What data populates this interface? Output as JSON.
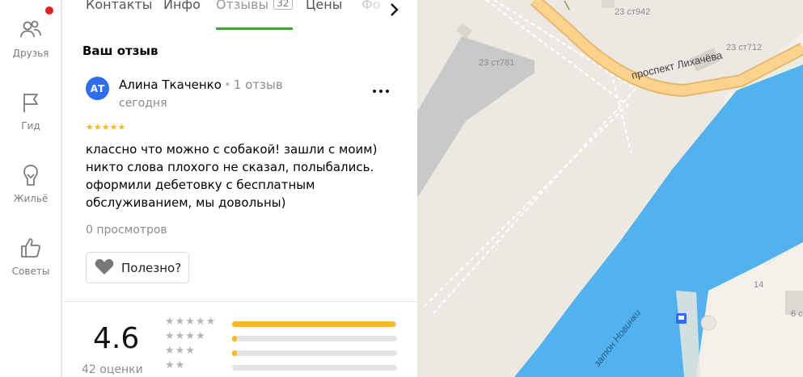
{
  "sidebar": {
    "items": [
      {
        "label": "Друзья",
        "icon": "friends-icon"
      },
      {
        "label": "Гид",
        "icon": "flag-icon"
      },
      {
        "label": "Жильё",
        "icon": "housing-icon"
      },
      {
        "label": "Советы",
        "icon": "thumbs-up-icon"
      }
    ],
    "notification_color": "#e51e1e"
  },
  "tabs": [
    {
      "label": "Контакты",
      "count": null,
      "active": false
    },
    {
      "label": "Инфо",
      "count": null,
      "active": false
    },
    {
      "label": "Отзывы",
      "count": "32",
      "active": true
    },
    {
      "label": "Цены",
      "count": null,
      "active": false
    },
    {
      "label": "Фо",
      "count": null,
      "active": false
    }
  ],
  "tabs_next_icon": "chevron-right-icon",
  "review": {
    "section_title": "Ваш отзыв",
    "avatar_initials": "АТ",
    "avatar_color": "#2e6dee",
    "author": "Алина Ткаченко",
    "author_reviews": "1 отзыв",
    "date": "сегодня",
    "rating": 5,
    "text_lines": [
      "классно что можно с собакой! зашли с моим)",
      "никто слова плохого не сказал, полыбались.",
      "оформили дебетовку с бесплатным",
      "обслуживанием, мы довольны)"
    ],
    "views": "0 просмотров",
    "useful_label": "Полезно?"
  },
  "rating_summary": {
    "value": "4.6",
    "count_label": "42 оценки",
    "distribution": [
      {
        "stars": 5,
        "fraction": 0.99
      },
      {
        "stars": 4,
        "fraction": 0.03
      },
      {
        "stars": 3,
        "fraction": 0.03
      },
      {
        "stars": 2,
        "fraction": 0.0
      }
    ],
    "bar_color": "#fcb71e"
  },
  "map": {
    "street_label": "проспект Лихачёва",
    "water_label": "затон Новинки",
    "building_labels": [
      "23 ст942",
      "23 ст712",
      "23 ст781",
      "14",
      "6 с"
    ],
    "water_color": "#53b2ee",
    "road_color": "#fbd38d"
  }
}
